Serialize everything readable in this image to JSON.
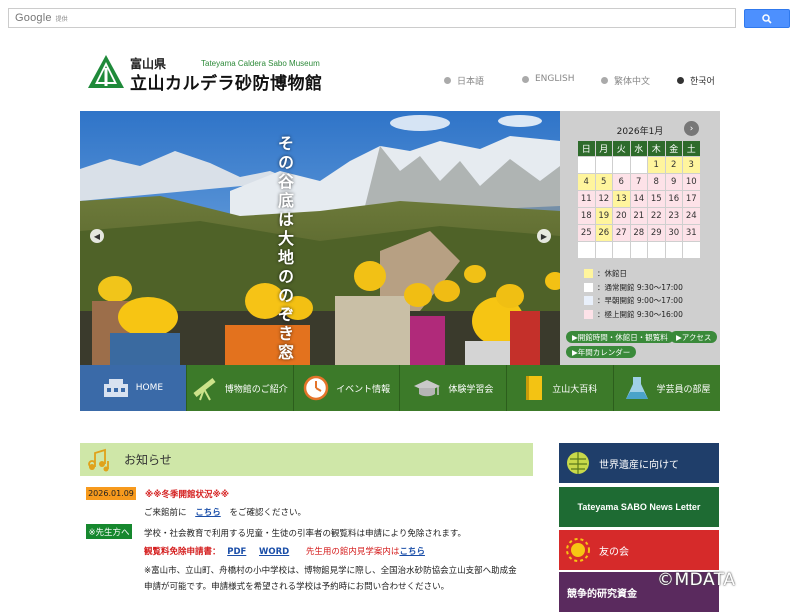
{
  "search": {
    "logo": "Google",
    "sub": "提供"
  },
  "header": {
    "pref": "富山県",
    "en_name": "Tateyama Caldera Sabo Museum",
    "ja_name": "立山カルデラ砂防博物館",
    "languages": [
      "日本語",
      "ENGLISH",
      "繁体中文",
      "한국어"
    ]
  },
  "hero": {
    "vertical_title": "その谷底は大地ののぞき窓"
  },
  "calendar": {
    "month": "2026年1月",
    "weekdays": [
      "日",
      "月",
      "火",
      "水",
      "木",
      "金",
      "土"
    ],
    "rows": [
      [
        "",
        "",
        "",
        "",
        "1",
        "2",
        "3"
      ],
      [
        "4",
        "5",
        "6",
        "7",
        "8",
        "9",
        "10"
      ],
      [
        "11",
        "12",
        "13",
        "14",
        "15",
        "16",
        "17"
      ],
      [
        "18",
        "19",
        "20",
        "21",
        "22",
        "23",
        "24"
      ],
      [
        "25",
        "26",
        "27",
        "28",
        "29",
        "30",
        "31"
      ],
      [
        "",
        "",
        "",
        "",
        "",
        "",
        ""
      ]
    ],
    "legend": [
      {
        "label": "：休館日",
        "color": "#fff59d"
      },
      {
        "label": "：通常開館 9:30～17:00",
        "color": "#ffffff"
      },
      {
        "label": "：早朝開館 9:00～17:00",
        "color": "#e9f0fb"
      },
      {
        "label": "：極上開館 9:30～16:00",
        "color": "#fde2e8"
      }
    ],
    "buttons": [
      "▶開館時間・休館日・観覧料",
      "▶アクセス",
      "▶年間カレンダー"
    ]
  },
  "nav": [
    {
      "label": "HOME",
      "icon": "museum-building-icon"
    },
    {
      "label": "博物館のご紹介",
      "icon": "telescope-icon"
    },
    {
      "label": "イベント情報",
      "icon": "clock-icon"
    },
    {
      "label": "体験学習会",
      "icon": "graduation-cap-icon"
    },
    {
      "label": "立山大百科",
      "icon": "book-icon"
    },
    {
      "label": "学芸員の部屋",
      "icon": "flask-icon"
    }
  ],
  "news": {
    "title": "お知らせ",
    "date": "2026.01.09",
    "item1_title": "※※冬季開館状況※※",
    "item1_pre": "ご来館前に",
    "item1_link": "こちら",
    "item1_post": "をご確認ください。",
    "teachers_badge": "※先生方へ",
    "teachers_text": "学校・社会教育で利用する児童・生徒の引率者の観覧料は申請により免除されます。",
    "form_label": "観覧料免除申請書：",
    "form_pdf": "PDF",
    "form_word": "WORD",
    "guide_pre": "先生用の館内見学案内は",
    "guide_link": "こちら",
    "note_line1": "※富山市、立山町、舟橋村の小中学校は、博物館見学に際し、全国治水砂防協会立山支部へ助成金",
    "note_line2": "申請が可能です。申請様式を希望される学校は予約時にお問い合わせください。"
  },
  "banners": [
    {
      "label": "世界遺産に向けて",
      "color": "#1f3e6a",
      "icon": "globe-icon"
    },
    {
      "label": "Tateyama SABO News Letter",
      "color": "#1e6b33",
      "icon": ""
    },
    {
      "label": "友の会",
      "color": "#d62a2a",
      "icon": "sun-icon"
    },
    {
      "label": "競争的研究資金",
      "color": "#5a2a5e",
      "icon": ""
    }
  ],
  "watermark": "©MDATA"
}
